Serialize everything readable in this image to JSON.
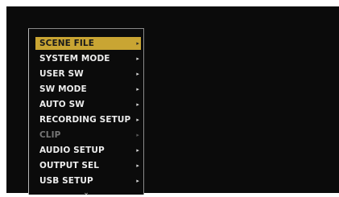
{
  "menu": {
    "items": [
      {
        "label": "SCENE FILE",
        "arrow": "▸",
        "state": "selected"
      },
      {
        "label": "SYSTEM MODE",
        "arrow": "▸",
        "state": "normal"
      },
      {
        "label": "USER SW",
        "arrow": "▸",
        "state": "normal"
      },
      {
        "label": "SW MODE",
        "arrow": "▸",
        "state": "normal"
      },
      {
        "label": "AUTO SW",
        "arrow": "▸",
        "state": "normal"
      },
      {
        "label": "RECORDING SETUP",
        "arrow": "▸",
        "state": "normal"
      },
      {
        "label": "CLIP",
        "arrow": "▸",
        "state": "disabled"
      },
      {
        "label": "AUDIO SETUP",
        "arrow": "▸",
        "state": "normal"
      },
      {
        "label": "OUTPUT SEL",
        "arrow": "▸",
        "state": "normal"
      },
      {
        "label": "USB SETUP",
        "arrow": "▸",
        "state": "normal"
      }
    ],
    "scroll_indicator": "⌄"
  },
  "colors": {
    "highlight": "#c9a533",
    "background": "#0b0b0b",
    "text": "#ececec",
    "disabled_text": "#767676"
  }
}
